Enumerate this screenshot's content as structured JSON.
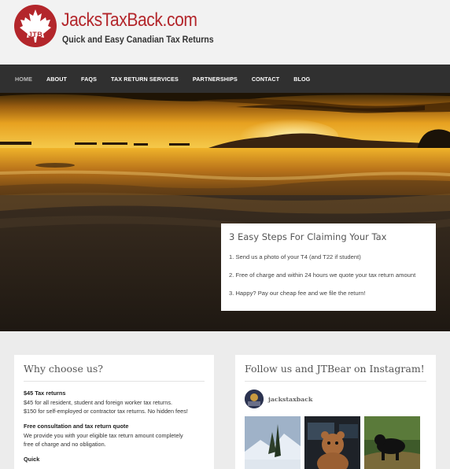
{
  "header": {
    "logo_initials": "JTB",
    "site_title": "JacksTaxBack.com",
    "tagline": "Quick and Easy Canadian Tax Returns",
    "brand_color": "#b3262b"
  },
  "nav": {
    "items": [
      {
        "label": "HOME",
        "active": true
      },
      {
        "label": "ABOUT"
      },
      {
        "label": "FAQS"
      },
      {
        "label": "TAX RETURN SERVICES"
      },
      {
        "label": "PARTNERSHIPS"
      },
      {
        "label": "CONTACT"
      },
      {
        "label": "BLOG"
      }
    ]
  },
  "steps": {
    "title": "3 Easy Steps For Claiming Your Tax",
    "items": [
      "1.  Send us a photo of your T4 (and T22 if student)",
      "2.  Free of charge and within 24 hours we quote your tax return amount",
      "3.  Happy? Pay our cheap fee and we file the return!"
    ]
  },
  "why": {
    "title": "Why choose us?",
    "blocks": [
      {
        "heading": "$45 Tax returns",
        "lines": [
          "$45 for all resident, student and foreign worker tax returns.",
          "$150 for self-employed or contractor tax returns. No hidden fees!"
        ]
      },
      {
        "heading": "Free consultation and tax return quote",
        "lines": [
          "We provide you with your eligible tax return amount completely",
          "free of charge and no obligation."
        ]
      },
      {
        "heading": "Quick",
        "lines": []
      }
    ]
  },
  "instagram": {
    "title": "Follow us and JTBear on Instagram!",
    "username": "jackstaxback",
    "photo_icons": [
      "mountain-photo",
      "teddy-bear-photo",
      "black-bear-photo"
    ]
  }
}
